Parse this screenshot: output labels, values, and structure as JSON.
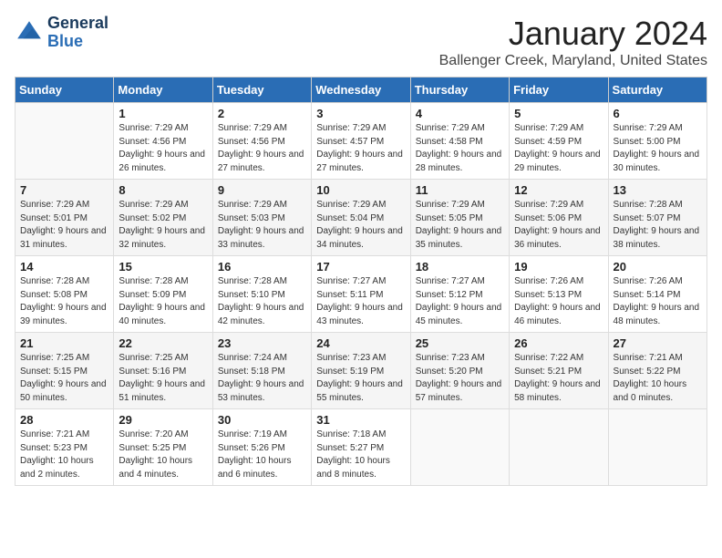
{
  "header": {
    "logo_general": "General",
    "logo_blue": "Blue",
    "month": "January 2024",
    "location": "Ballenger Creek, Maryland, United States"
  },
  "columns": [
    "Sunday",
    "Monday",
    "Tuesday",
    "Wednesday",
    "Thursday",
    "Friday",
    "Saturday"
  ],
  "rows": [
    [
      {
        "day": "",
        "sunrise": "",
        "sunset": "",
        "daylight": ""
      },
      {
        "day": "1",
        "sunrise": "Sunrise: 7:29 AM",
        "sunset": "Sunset: 4:56 PM",
        "daylight": "Daylight: 9 hours and 26 minutes."
      },
      {
        "day": "2",
        "sunrise": "Sunrise: 7:29 AM",
        "sunset": "Sunset: 4:56 PM",
        "daylight": "Daylight: 9 hours and 27 minutes."
      },
      {
        "day": "3",
        "sunrise": "Sunrise: 7:29 AM",
        "sunset": "Sunset: 4:57 PM",
        "daylight": "Daylight: 9 hours and 27 minutes."
      },
      {
        "day": "4",
        "sunrise": "Sunrise: 7:29 AM",
        "sunset": "Sunset: 4:58 PM",
        "daylight": "Daylight: 9 hours and 28 minutes."
      },
      {
        "day": "5",
        "sunrise": "Sunrise: 7:29 AM",
        "sunset": "Sunset: 4:59 PM",
        "daylight": "Daylight: 9 hours and 29 minutes."
      },
      {
        "day": "6",
        "sunrise": "Sunrise: 7:29 AM",
        "sunset": "Sunset: 5:00 PM",
        "daylight": "Daylight: 9 hours and 30 minutes."
      }
    ],
    [
      {
        "day": "7",
        "sunrise": "Sunrise: 7:29 AM",
        "sunset": "Sunset: 5:01 PM",
        "daylight": "Daylight: 9 hours and 31 minutes."
      },
      {
        "day": "8",
        "sunrise": "Sunrise: 7:29 AM",
        "sunset": "Sunset: 5:02 PM",
        "daylight": "Daylight: 9 hours and 32 minutes."
      },
      {
        "day": "9",
        "sunrise": "Sunrise: 7:29 AM",
        "sunset": "Sunset: 5:03 PM",
        "daylight": "Daylight: 9 hours and 33 minutes."
      },
      {
        "day": "10",
        "sunrise": "Sunrise: 7:29 AM",
        "sunset": "Sunset: 5:04 PM",
        "daylight": "Daylight: 9 hours and 34 minutes."
      },
      {
        "day": "11",
        "sunrise": "Sunrise: 7:29 AM",
        "sunset": "Sunset: 5:05 PM",
        "daylight": "Daylight: 9 hours and 35 minutes."
      },
      {
        "day": "12",
        "sunrise": "Sunrise: 7:29 AM",
        "sunset": "Sunset: 5:06 PM",
        "daylight": "Daylight: 9 hours and 36 minutes."
      },
      {
        "day": "13",
        "sunrise": "Sunrise: 7:28 AM",
        "sunset": "Sunset: 5:07 PM",
        "daylight": "Daylight: 9 hours and 38 minutes."
      }
    ],
    [
      {
        "day": "14",
        "sunrise": "Sunrise: 7:28 AM",
        "sunset": "Sunset: 5:08 PM",
        "daylight": "Daylight: 9 hours and 39 minutes."
      },
      {
        "day": "15",
        "sunrise": "Sunrise: 7:28 AM",
        "sunset": "Sunset: 5:09 PM",
        "daylight": "Daylight: 9 hours and 40 minutes."
      },
      {
        "day": "16",
        "sunrise": "Sunrise: 7:28 AM",
        "sunset": "Sunset: 5:10 PM",
        "daylight": "Daylight: 9 hours and 42 minutes."
      },
      {
        "day": "17",
        "sunrise": "Sunrise: 7:27 AM",
        "sunset": "Sunset: 5:11 PM",
        "daylight": "Daylight: 9 hours and 43 minutes."
      },
      {
        "day": "18",
        "sunrise": "Sunrise: 7:27 AM",
        "sunset": "Sunset: 5:12 PM",
        "daylight": "Daylight: 9 hours and 45 minutes."
      },
      {
        "day": "19",
        "sunrise": "Sunrise: 7:26 AM",
        "sunset": "Sunset: 5:13 PM",
        "daylight": "Daylight: 9 hours and 46 minutes."
      },
      {
        "day": "20",
        "sunrise": "Sunrise: 7:26 AM",
        "sunset": "Sunset: 5:14 PM",
        "daylight": "Daylight: 9 hours and 48 minutes."
      }
    ],
    [
      {
        "day": "21",
        "sunrise": "Sunrise: 7:25 AM",
        "sunset": "Sunset: 5:15 PM",
        "daylight": "Daylight: 9 hours and 50 minutes."
      },
      {
        "day": "22",
        "sunrise": "Sunrise: 7:25 AM",
        "sunset": "Sunset: 5:16 PM",
        "daylight": "Daylight: 9 hours and 51 minutes."
      },
      {
        "day": "23",
        "sunrise": "Sunrise: 7:24 AM",
        "sunset": "Sunset: 5:18 PM",
        "daylight": "Daylight: 9 hours and 53 minutes."
      },
      {
        "day": "24",
        "sunrise": "Sunrise: 7:23 AM",
        "sunset": "Sunset: 5:19 PM",
        "daylight": "Daylight: 9 hours and 55 minutes."
      },
      {
        "day": "25",
        "sunrise": "Sunrise: 7:23 AM",
        "sunset": "Sunset: 5:20 PM",
        "daylight": "Daylight: 9 hours and 57 minutes."
      },
      {
        "day": "26",
        "sunrise": "Sunrise: 7:22 AM",
        "sunset": "Sunset: 5:21 PM",
        "daylight": "Daylight: 9 hours and 58 minutes."
      },
      {
        "day": "27",
        "sunrise": "Sunrise: 7:21 AM",
        "sunset": "Sunset: 5:22 PM",
        "daylight": "Daylight: 10 hours and 0 minutes."
      }
    ],
    [
      {
        "day": "28",
        "sunrise": "Sunrise: 7:21 AM",
        "sunset": "Sunset: 5:23 PM",
        "daylight": "Daylight: 10 hours and 2 minutes."
      },
      {
        "day": "29",
        "sunrise": "Sunrise: 7:20 AM",
        "sunset": "Sunset: 5:25 PM",
        "daylight": "Daylight: 10 hours and 4 minutes."
      },
      {
        "day": "30",
        "sunrise": "Sunrise: 7:19 AM",
        "sunset": "Sunset: 5:26 PM",
        "daylight": "Daylight: 10 hours and 6 minutes."
      },
      {
        "day": "31",
        "sunrise": "Sunrise: 7:18 AM",
        "sunset": "Sunset: 5:27 PM",
        "daylight": "Daylight: 10 hours and 8 minutes."
      },
      {
        "day": "",
        "sunrise": "",
        "sunset": "",
        "daylight": ""
      },
      {
        "day": "",
        "sunrise": "",
        "sunset": "",
        "daylight": ""
      },
      {
        "day": "",
        "sunrise": "",
        "sunset": "",
        "daylight": ""
      }
    ]
  ]
}
